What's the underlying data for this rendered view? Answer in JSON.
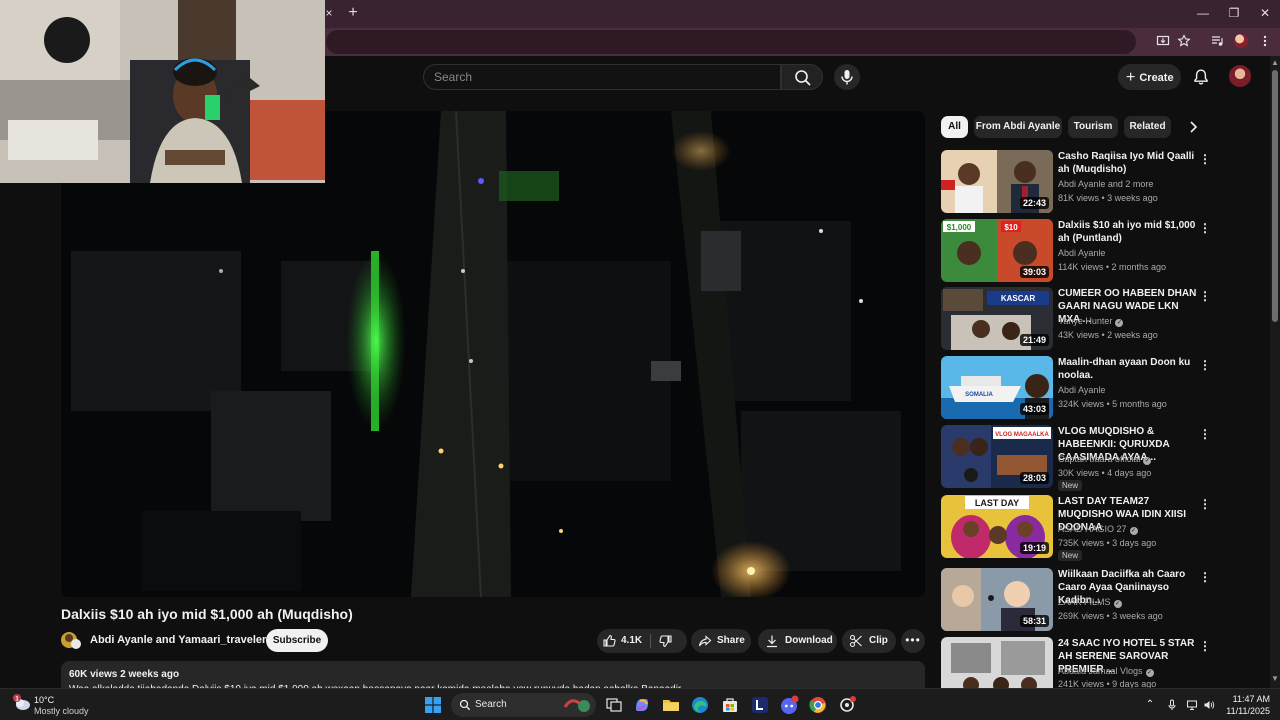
{
  "browser": {
    "tab_close_glyph": "×",
    "new_tab_glyph": "+",
    "window_controls": [
      "—",
      "❐",
      "✕"
    ]
  },
  "youtube_header": {
    "search_placeholder": "Search",
    "create_label": "Create"
  },
  "video": {
    "title": "Dalxiis $10 ah iyo mid $1,000 ah (Muqdisho)",
    "channel": "Abdi Ayanle and Yamaari_traveler",
    "subscribe_label": "Subscribe",
    "likes": "4.1K",
    "share_label": "Share",
    "download_label": "Download",
    "clip_label": "Clip",
    "more_glyph": "•••"
  },
  "description": {
    "meta": "60K views  2 weeks ago",
    "text": "Waa alkaladda tiiabadanda Dalviis $10 iya mid $1,000 ab wexaan beesanaya naar kamida meelaba yew runuyda hadan aabalka Banaadir"
  },
  "chips": {
    "items": [
      "All",
      "From Abdi Ayanle",
      "Tourism",
      "Related"
    ],
    "active_index": 0
  },
  "recommendations": [
    {
      "title": "Casho Raqiisa Iyo Mid Qaalli ah (Muqdisho)",
      "channel": "Abdi Ayanle and 2 more",
      "verified": false,
      "stats": "81K views • 3 weeks ago",
      "duration": "22:43",
      "badge": ""
    },
    {
      "title": "Dalxiis $10 ah iyo mid $1,000 ah (Puntland)",
      "channel": "Abdi Ayanle",
      "verified": false,
      "stats": "114K views • 2 months ago",
      "duration": "39:03",
      "badge": ""
    },
    {
      "title": "CUMEER OO HABEEN DHAN GAARI NAGU WADE LKN MXA ...",
      "channel": "Yahye Hunter",
      "verified": true,
      "stats": "43K views • 2 weeks ago",
      "duration": "21:49",
      "badge": ""
    },
    {
      "title": "Maalin-dhan ayaan Doon ku noolaa.",
      "channel": "Abdi Ayanle",
      "verified": false,
      "stats": "324K views • 5 months ago",
      "duration": "43:03",
      "badge": ""
    },
    {
      "title": "VLOG MUQDISHO & HABEENKII: QURUXDA CAASIMADA AYAA...",
      "channel": "Captan baara official",
      "verified": true,
      "stats": "30K views • 4 days ago",
      "duration": "28:03",
      "badge": "New"
    },
    {
      "title": "LAST DAY TEAM27 MUQDISHO WAA IDIN XIISI DOONAA",
      "channel": "ASAD HAGIO 27",
      "verified": true,
      "stats": "735K views • 3 days ago",
      "duration": "19:19",
      "badge": "New"
    },
    {
      "title": "Wiilkaan Daciifka ah Caaro Caaro Ayaa Qaniinayso Kadibn...",
      "channel": "ZAAK FILMS",
      "verified": true,
      "stats": "269K views • 3 weeks ago",
      "duration": "58:31",
      "badge": ""
    },
    {
      "title": "24 SAAC IYO HOTEL 5 STAR AH SERENE SAROVAR PREMIER ...",
      "channel": "Abdala Jamaal Vlogs",
      "verified": true,
      "stats": "241K views • 9 days ago",
      "duration": "",
      "badge": ""
    }
  ],
  "thumb_texts": {
    "t2_price_a": "$1,000",
    "t2_price_b": "$10",
    "t3_label": "KASCAR",
    "t4_label": "SOMALIA",
    "t5_label": "VLOG MAGAALKA",
    "t6_label": "LAST DAY"
  },
  "taskbar": {
    "weather_temp": "10°C",
    "weather_desc": "Mostly cloudy",
    "weather_badge": "1",
    "search_label": "Search",
    "time": "11:47 AM",
    "date": "11/11/2025",
    "apps": [
      "task-view",
      "copilot",
      "file-explorer",
      "edge",
      "store",
      "l-app",
      "discord",
      "chrome",
      "settings"
    ]
  },
  "colors": {
    "background": "#0f0f0f",
    "chrome_tabbar": "#3a2330",
    "chrome_toolbar": "#4a2c3c",
    "pill": "#272727",
    "text_secondary": "#aaaaaa"
  }
}
